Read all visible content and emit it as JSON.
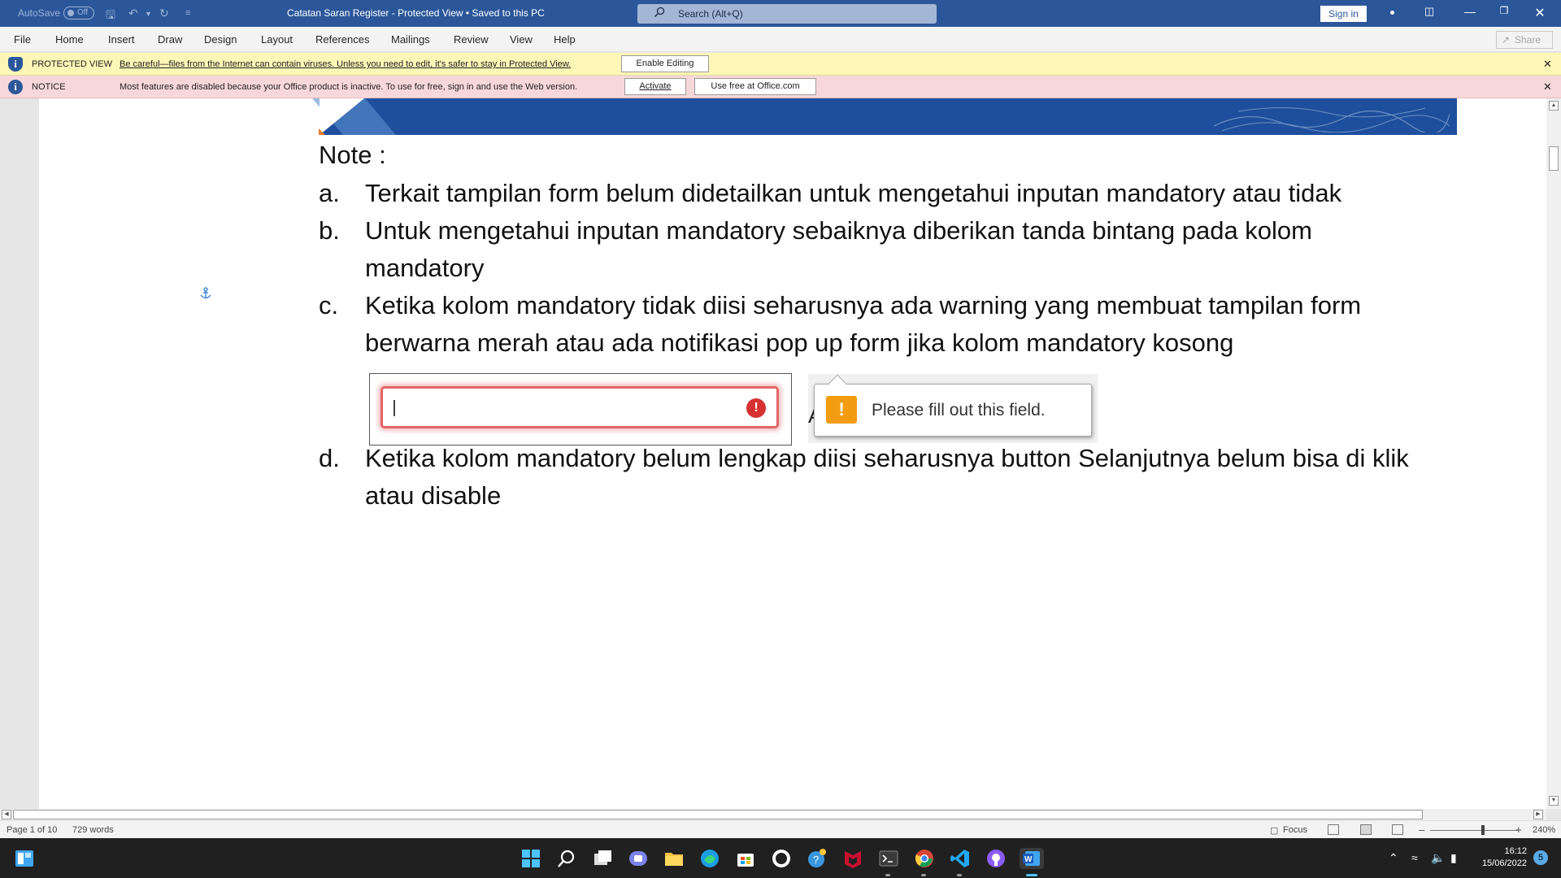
{
  "titlebar": {
    "autosave_label": "AutoSave",
    "autosave_state": "Off",
    "document_title": "Catatan Saran Register  -  Protected View • Saved to this PC",
    "search_placeholder": "Search (Alt+Q)",
    "sign_in_label": "Sign in"
  },
  "ribbon": {
    "tabs": [
      "File",
      "Home",
      "Insert",
      "Draw",
      "Design",
      "Layout",
      "References",
      "Mailings",
      "Review",
      "View",
      "Help"
    ],
    "share_label": "Share"
  },
  "protected_bar": {
    "label": "PROTECTED VIEW",
    "message": "Be careful—files from the Internet can contain viruses. Unless you need to edit, it's safer to stay in Protected View.",
    "button": "Enable Editing"
  },
  "notice_bar": {
    "label": "NOTICE",
    "message": "Most features are disabled because your Office product is inactive. To use for free, sign in and use the Web version.",
    "activate_button": "Activate",
    "web_button": "Use free at Office.com"
  },
  "document": {
    "heading": "Note :",
    "items": [
      {
        "letter": "a.",
        "text": "Terkait tampilan form belum didetailkan untuk mengetahui inputan mandatory atau tidak"
      },
      {
        "letter": "b.",
        "text": "Untuk mengetahui inputan mandatory sebaiknya diberikan tanda bintang pada kolom mandatory"
      },
      {
        "letter": "c.",
        "text": "Ketika kolom mandatory tidak diisi seharusnya ada warning yang membuat tampilan form berwarna merah  atau ada notifikasi pop up form jika kolom mandatory kosong"
      },
      {
        "letter": "d.",
        "text": "Ketika kolom mandatory belum lengkap diisi seharusnya button Selanjutnya belum bisa di klik atau disable"
      }
    ],
    "popup_text": "Please fill out this field."
  },
  "statusbar": {
    "page": "Page 1 of 10",
    "words": "729 words",
    "focus": "Focus",
    "zoom": "240%"
  },
  "taskbar": {
    "time": "16:12",
    "date": "15/06/2022",
    "notification_count": "5"
  },
  "colors": {
    "word_blue": "#2b579a",
    "protected_yellow": "#fcf7b6",
    "notice_pink": "#f8d7da",
    "error_red": "#e26565",
    "warning_orange": "#f39c12"
  }
}
